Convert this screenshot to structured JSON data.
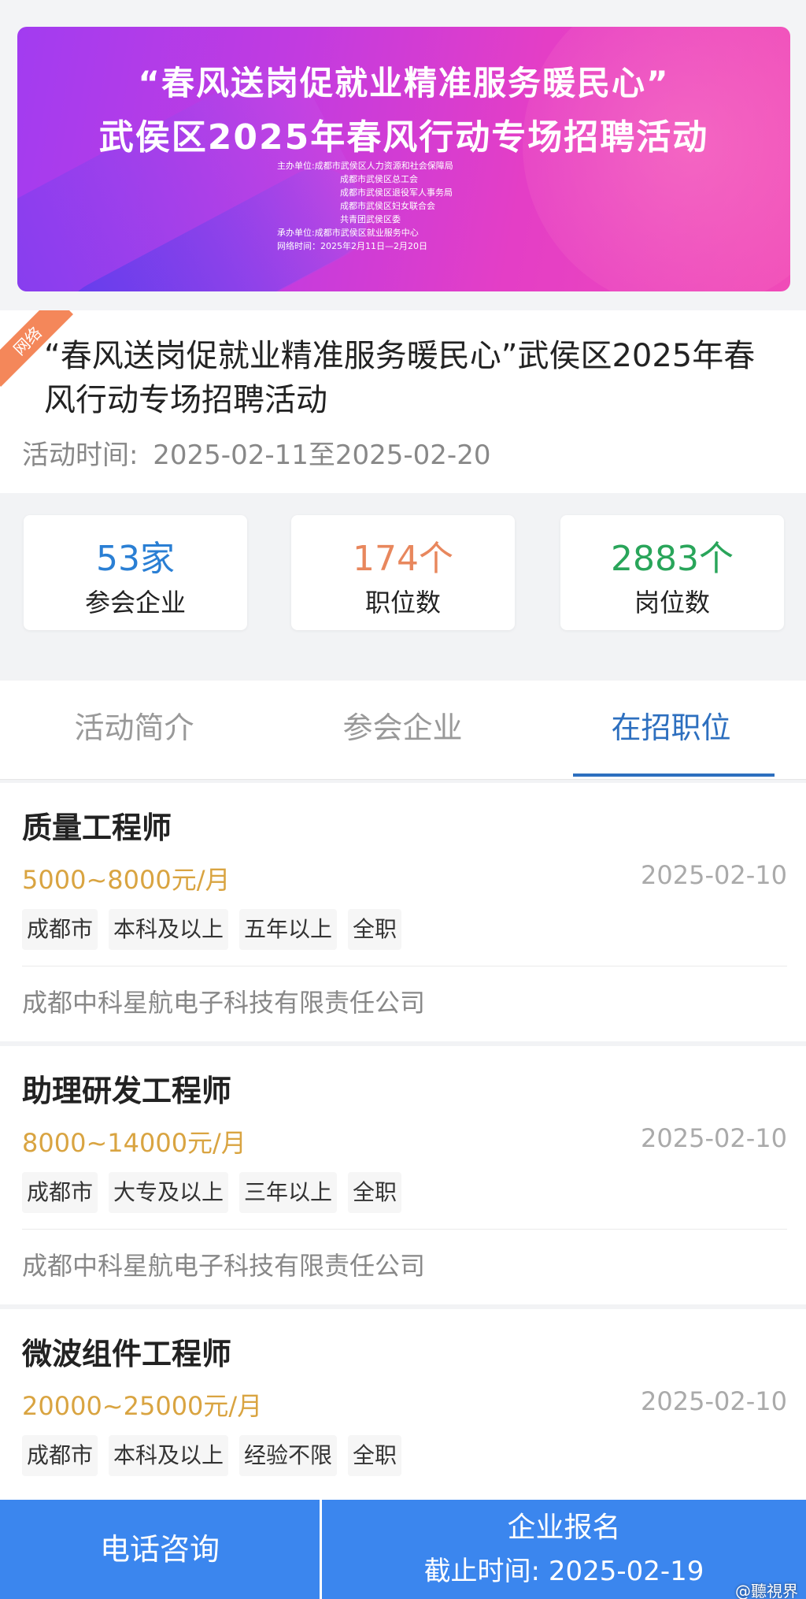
{
  "banner": {
    "line1": "“春风送岗促就业精准服务暖民心”",
    "line2": "武侯区2025年春风行动专场招聘活动",
    "organizers": [
      "主办单位:成都市武侯区人力资源和社会保障局",
      "成都市武侯区总工会",
      "成都市武侯区退役军人事务局",
      "成都市武侯区妇女联合会",
      "共青团武侯区委",
      "承办单位:成都市武侯区就业服务中心",
      "网络时间：2025年2月11日—2月20日"
    ]
  },
  "event": {
    "badge": "网络",
    "title": "“春风送岗促就业精准服务暖民心”武侯区2025年春风行动专场招聘活动",
    "time_label": "活动时间:",
    "time_value": "2025-02-11至2025-02-20"
  },
  "stats": [
    {
      "value": "53家",
      "label": "参会企业",
      "color": "#2a7fd4"
    },
    {
      "value": "174个",
      "label": "职位数",
      "color": "#e8875d"
    },
    {
      "value": "2883个",
      "label": "岗位数",
      "color": "#29a55a"
    }
  ],
  "tabs": [
    {
      "label": "活动简介",
      "active": false
    },
    {
      "label": "参会企业",
      "active": false
    },
    {
      "label": "在招职位",
      "active": true
    }
  ],
  "jobs": [
    {
      "title": "质量工程师",
      "salary": "5000~8000元/月",
      "date": "2025-02-10",
      "tags": [
        "成都市",
        "本科及以上",
        "五年以上",
        "全职"
      ],
      "company": "成都中科星航电子科技有限责任公司"
    },
    {
      "title": "助理研发工程师",
      "salary": "8000~14000元/月",
      "date": "2025-02-10",
      "tags": [
        "成都市",
        "大专及以上",
        "三年以上",
        "全职"
      ],
      "company": "成都中科星航电子科技有限责任公司"
    },
    {
      "title": "微波组件工程师",
      "salary": "20000~25000元/月",
      "date": "2025-02-10",
      "tags": [
        "成都市",
        "本科及以上",
        "经验不限",
        "全职"
      ],
      "company": ""
    }
  ],
  "bottom_bar": {
    "call_label": "电话咨询",
    "register_label": "企业报名",
    "deadline": "截止时间:  2025-02-19"
  },
  "watermark": "@聽視界",
  "colors": {
    "accent_blue": "#3b86ee",
    "tab_active": "#2d6fbf",
    "salary": "#d9a441",
    "badge": "#f4875a"
  }
}
